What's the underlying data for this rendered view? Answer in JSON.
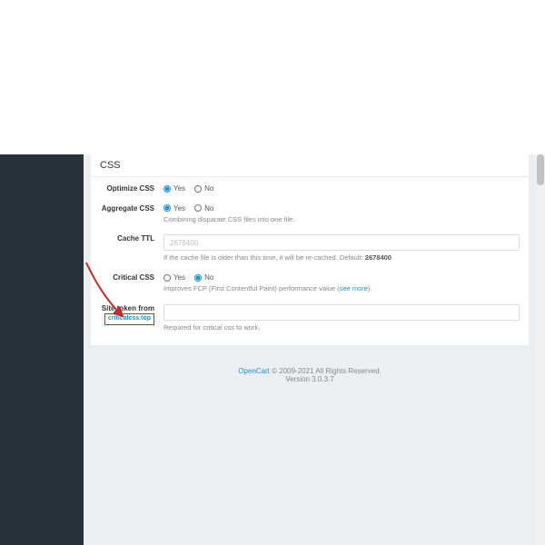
{
  "panel": {
    "title": "CSS"
  },
  "optimize": {
    "label": "Optimize CSS",
    "yes": "Yes",
    "no": "No"
  },
  "aggregate": {
    "label": "Aggregate CSS",
    "yes": "Yes",
    "no": "No",
    "hint": "Combining disparate CSS files into one file."
  },
  "ttl": {
    "label": "Cache TTL",
    "placeholder": "2676400",
    "hint_a": "If the cache file is older than this time, it will be re-cached. Default: ",
    "hint_b": "2678400",
    "hint_c": "."
  },
  "critical": {
    "label": "Critical CSS",
    "yes": "Yes",
    "no": "No",
    "hint_a": "Improves FCP (First Contentful Paint) performance value (",
    "hint_link": "see more",
    "hint_b": ")."
  },
  "token": {
    "label_a": "Site token from",
    "label_link": "criticalcss.top",
    "hint": "Required for critical css to work."
  },
  "footer": {
    "brand": "OpenCart",
    "copy": " © 2009-2021 All Rights Reserved.",
    "version": "Version 3.0.3.7"
  }
}
